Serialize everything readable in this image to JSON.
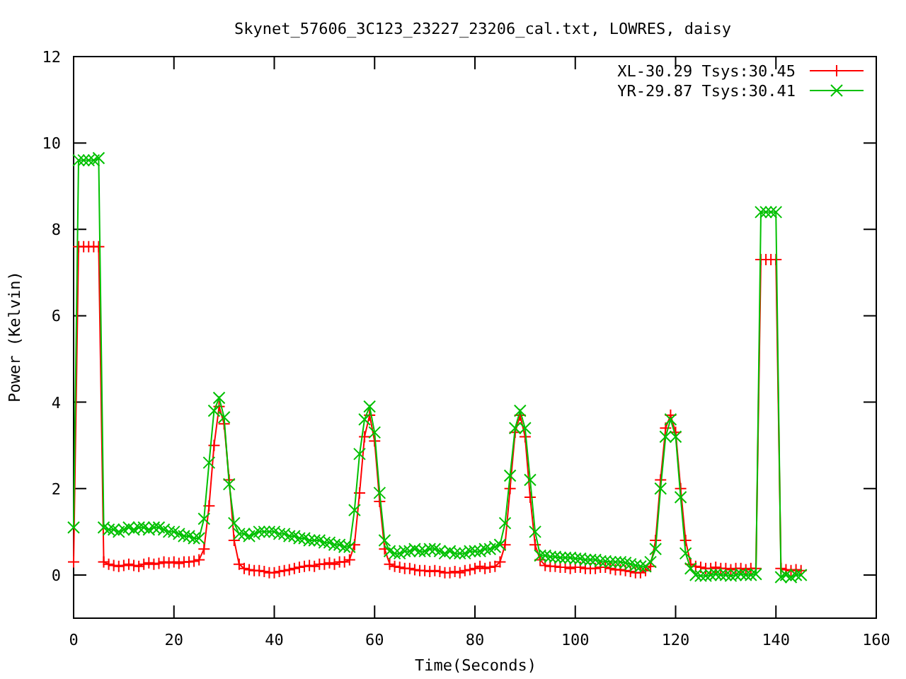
{
  "chart_data": {
    "type": "line",
    "title": "Skynet_57606_3C123_23227_23206_cal.txt, LOWRES, daisy",
    "xlabel": "Time(Seconds)",
    "ylabel": "Power (Kelvin)",
    "xlim": [
      0,
      160
    ],
    "ylim": [
      -1,
      12
    ],
    "xticks": [
      0,
      20,
      40,
      60,
      80,
      100,
      120,
      140,
      160
    ],
    "yticks": [
      0,
      2,
      4,
      6,
      8,
      10,
      12
    ],
    "legend": "upper right",
    "x": [
      0,
      1,
      2,
      3,
      4,
      5,
      6,
      7,
      8,
      9,
      10,
      11,
      12,
      13,
      14,
      15,
      16,
      17,
      18,
      19,
      20,
      21,
      22,
      23,
      24,
      25,
      26,
      27,
      28,
      29,
      30,
      31,
      32,
      33,
      34,
      35,
      36,
      37,
      38,
      39,
      40,
      41,
      42,
      43,
      44,
      45,
      46,
      47,
      48,
      49,
      50,
      51,
      52,
      53,
      54,
      55,
      56,
      57,
      58,
      59,
      60,
      61,
      62,
      63,
      64,
      65,
      66,
      67,
      68,
      69,
      70,
      71,
      72,
      73,
      74,
      75,
      76,
      77,
      78,
      79,
      80,
      81,
      82,
      83,
      84,
      85,
      86,
      87,
      88,
      89,
      90,
      91,
      92,
      93,
      94,
      95,
      96,
      97,
      98,
      99,
      100,
      101,
      102,
      103,
      104,
      105,
      106,
      107,
      108,
      109,
      110,
      111,
      112,
      113,
      114,
      115,
      116,
      117,
      118,
      119,
      120,
      121,
      122,
      123,
      124,
      125,
      126,
      127,
      128,
      129,
      130,
      131,
      132,
      133,
      134,
      135,
      136,
      137,
      138,
      139,
      140,
      141,
      142,
      143,
      144,
      145
    ],
    "series": [
      {
        "name": "XL-30.29 Tsys:30.45",
        "color": "#ff0000",
        "marker": "plus",
        "values": [
          0.3,
          7.6,
          7.6,
          7.6,
          7.6,
          7.6,
          0.3,
          0.25,
          0.22,
          0.2,
          0.22,
          0.25,
          0.22,
          0.2,
          0.25,
          0.28,
          0.25,
          0.27,
          0.3,
          0.28,
          0.3,
          0.27,
          0.3,
          0.3,
          0.32,
          0.35,
          0.6,
          1.6,
          3.0,
          3.9,
          3.5,
          2.2,
          0.8,
          0.25,
          0.15,
          0.12,
          0.1,
          0.1,
          0.08,
          0.05,
          0.05,
          0.08,
          0.1,
          0.12,
          0.15,
          0.18,
          0.2,
          0.22,
          0.2,
          0.25,
          0.25,
          0.28,
          0.25,
          0.3,
          0.3,
          0.35,
          0.7,
          1.9,
          3.2,
          3.7,
          3.1,
          1.7,
          0.6,
          0.25,
          0.2,
          0.18,
          0.15,
          0.15,
          0.12,
          0.1,
          0.1,
          0.08,
          0.1,
          0.08,
          0.05,
          0.05,
          0.08,
          0.05,
          0.1,
          0.12,
          0.15,
          0.2,
          0.15,
          0.18,
          0.2,
          0.3,
          0.7,
          2.0,
          3.3,
          3.7,
          3.2,
          1.8,
          0.7,
          0.35,
          0.22,
          0.2,
          0.2,
          0.18,
          0.18,
          0.15,
          0.18,
          0.18,
          0.15,
          0.15,
          0.15,
          0.18,
          0.18,
          0.15,
          0.12,
          0.12,
          0.1,
          0.08,
          0.05,
          0.05,
          0.1,
          0.2,
          0.8,
          2.2,
          3.4,
          3.7,
          3.3,
          2.0,
          0.8,
          0.25,
          0.2,
          0.18,
          0.15,
          0.15,
          0.18,
          0.15,
          0.15,
          0.12,
          0.15,
          0.15,
          0.12,
          0.15,
          0.15,
          7.3,
          7.3,
          7.3,
          7.3,
          0.15,
          0.12,
          0.1,
          0.12,
          0.1
        ]
      },
      {
        "name": "YR-29.87 Tsys:30.41",
        "color": "#00c000",
        "marker": "x",
        "values": [
          1.1,
          9.6,
          9.6,
          9.6,
          9.6,
          9.65,
          1.1,
          1.05,
          1.05,
          1.0,
          1.05,
          1.1,
          1.05,
          1.1,
          1.1,
          1.05,
          1.1,
          1.1,
          1.05,
          1.0,
          1.0,
          0.95,
          0.9,
          0.9,
          0.85,
          0.85,
          1.3,
          2.6,
          3.8,
          4.1,
          3.65,
          2.1,
          1.2,
          0.95,
          0.95,
          0.9,
          0.95,
          1.0,
          1.0,
          1.0,
          1.0,
          0.95,
          0.95,
          0.9,
          0.9,
          0.85,
          0.85,
          0.8,
          0.8,
          0.8,
          0.75,
          0.75,
          0.7,
          0.7,
          0.65,
          0.65,
          1.5,
          2.8,
          3.6,
          3.9,
          3.3,
          1.9,
          0.8,
          0.55,
          0.5,
          0.5,
          0.55,
          0.55,
          0.6,
          0.55,
          0.55,
          0.6,
          0.6,
          0.55,
          0.5,
          0.55,
          0.5,
          0.5,
          0.5,
          0.55,
          0.55,
          0.55,
          0.6,
          0.6,
          0.65,
          0.7,
          1.2,
          2.3,
          3.4,
          3.8,
          3.4,
          2.2,
          1.0,
          0.45,
          0.45,
          0.42,
          0.42,
          0.4,
          0.4,
          0.4,
          0.38,
          0.38,
          0.35,
          0.35,
          0.35,
          0.32,
          0.32,
          0.3,
          0.3,
          0.3,
          0.28,
          0.25,
          0.22,
          0.2,
          0.2,
          0.3,
          0.6,
          2.0,
          3.2,
          3.6,
          3.2,
          1.8,
          0.5,
          0.15,
          0.0,
          -0.02,
          -0.02,
          0.0,
          0.02,
          0.0,
          0.0,
          -0.02,
          0.0,
          0.02,
          0.0,
          0.0,
          0.02,
          8.4,
          8.4,
          8.4,
          8.4,
          -0.05,
          0.0,
          -0.05,
          0.0,
          0.0
        ]
      }
    ]
  }
}
